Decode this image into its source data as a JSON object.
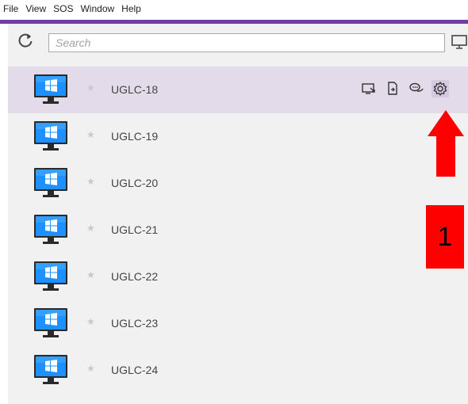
{
  "menubar": {
    "items": [
      "File",
      "View",
      "SOS",
      "Window",
      "Help"
    ]
  },
  "colors": {
    "accent": "#6e3fa0",
    "selected_row": "#e3dbea",
    "callout_red": "#ff0000",
    "windows_blue": "#1e90ff"
  },
  "toolbar": {
    "refresh_icon": "refresh-icon",
    "search_placeholder": "Search",
    "screen_icon": "monitor-icon"
  },
  "devices": [
    {
      "name": "UGLC-18",
      "selected": true
    },
    {
      "name": "UGLC-19",
      "selected": false
    },
    {
      "name": "UGLC-20",
      "selected": false
    },
    {
      "name": "UGLC-21",
      "selected": false
    },
    {
      "name": "UGLC-22",
      "selected": false
    },
    {
      "name": "UGLC-23",
      "selected": false
    },
    {
      "name": "UGLC-24",
      "selected": false
    }
  ],
  "row_actions": [
    "remote-view-icon",
    "file-transfer-icon",
    "chat-icon",
    "gear-icon"
  ],
  "annotation": {
    "label": "1",
    "arrow_icon": "red-up-arrow"
  }
}
